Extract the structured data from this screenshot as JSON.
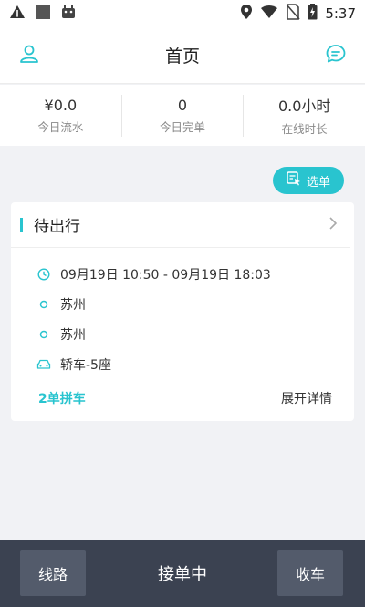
{
  "status_bar": {
    "time": "5:37",
    "icons": [
      "warning-icon",
      "notification-square-icon",
      "android-robot-icon",
      "location-icon",
      "wifi-icon",
      "no-sim-icon",
      "battery-charging-icon"
    ]
  },
  "header": {
    "title": "首页",
    "left_icon": "user-icon",
    "right_icon": "message-icon"
  },
  "stats": [
    {
      "value": "¥0.0",
      "label": "今日流水"
    },
    {
      "value": "0",
      "label": "今日完单"
    },
    {
      "value": "0.0小时",
      "label": "在线时长"
    }
  ],
  "select_button": {
    "label": "选单",
    "icon": "select-order-icon"
  },
  "order_card": {
    "title": "待出行",
    "time_range": "09月19日 10:50 - 09月19日 18:03",
    "origin": "苏州",
    "destination": "苏州",
    "car_type": "轿车-5座",
    "pool_label": "2单拼车",
    "expand_label": "展开详情"
  },
  "bottom_bar": {
    "left_label": "线路",
    "status": "接单中",
    "right_label": "收车"
  },
  "colors": {
    "accent": "#29c4cf",
    "bottom_bar": "#3b4251",
    "bottom_button": "#535b6b",
    "background": "#f1f2f5"
  }
}
